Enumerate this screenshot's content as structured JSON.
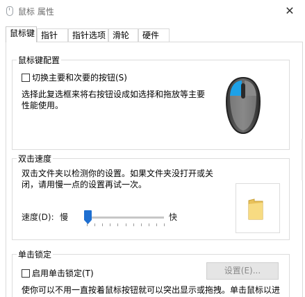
{
  "window": {
    "title": "鼠标 属性",
    "close_symbol": "✕"
  },
  "tabs": [
    {
      "label": "鼠标键",
      "active": true
    },
    {
      "label": "指针"
    },
    {
      "label": "指针选项"
    },
    {
      "label": "滑轮"
    },
    {
      "label": "硬件"
    }
  ],
  "button_config": {
    "title": "鼠标键配置",
    "checkbox_label": "切换主要和次要的按钮(S)",
    "checked": false,
    "description_lines": [
      "选择此复选框来将右按钮设成如选择和拖放等主要",
      "性能使用。"
    ]
  },
  "double_click": {
    "title": "双击速度",
    "description_lines": [
      "双击文件夹以检测你的设置。如果文件夹没打开或关",
      "闭，请用慢一点的设置再试一次。"
    ],
    "speed_label": "速度(D):",
    "slow_label": "慢",
    "fast_label": "快",
    "slider_fraction": 0.0
  },
  "click_lock": {
    "title": "单击锁定",
    "checkbox_label": "启用单击锁定(T)",
    "checked": false,
    "settings_button": "设置(E)...",
    "description_line": "使你可以不用一直按着鼠标按钮就可以突出显示或拖拽。单击鼠标以进"
  },
  "colors": {
    "accent": "#1e6fd1",
    "mouse_highlight": "#1da1e8"
  },
  "icons": {
    "app": "mouse-icon",
    "close": "close-icon",
    "folder": "folder-icon"
  }
}
